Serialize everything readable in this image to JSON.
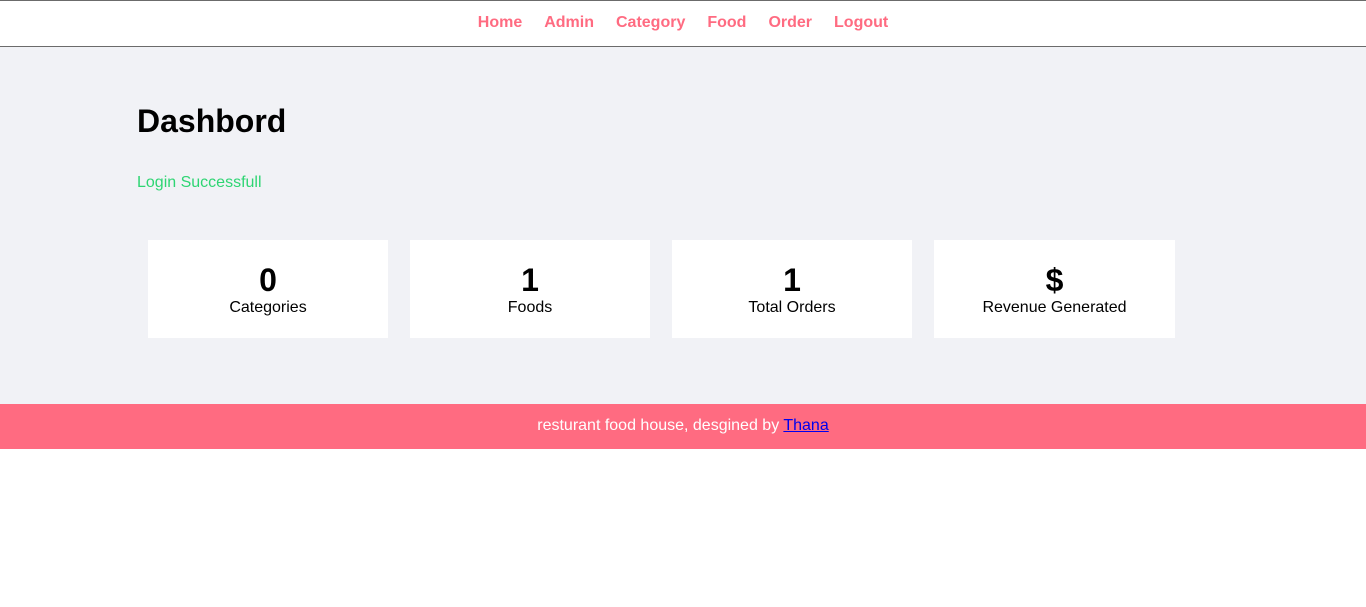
{
  "nav": {
    "items": [
      {
        "label": "Home"
      },
      {
        "label": "Admin"
      },
      {
        "label": "Category"
      },
      {
        "label": "Food"
      },
      {
        "label": "Order"
      },
      {
        "label": "Logout"
      }
    ]
  },
  "main": {
    "title": "Dashbord",
    "login_message": "Login Successfull",
    "stats": [
      {
        "value": "0",
        "label": "Categories"
      },
      {
        "value": "1",
        "label": "Foods"
      },
      {
        "value": "1",
        "label": "Total Orders"
      },
      {
        "value": "$",
        "label": "Revenue Generated"
      }
    ]
  },
  "footer": {
    "text": "resturant food house, desgined by ",
    "link_text": "Thana"
  },
  "colors": {
    "accent": "#ff6b81",
    "success": "#2ed573",
    "background": "#f1f2f6",
    "link": "#0000ee"
  }
}
